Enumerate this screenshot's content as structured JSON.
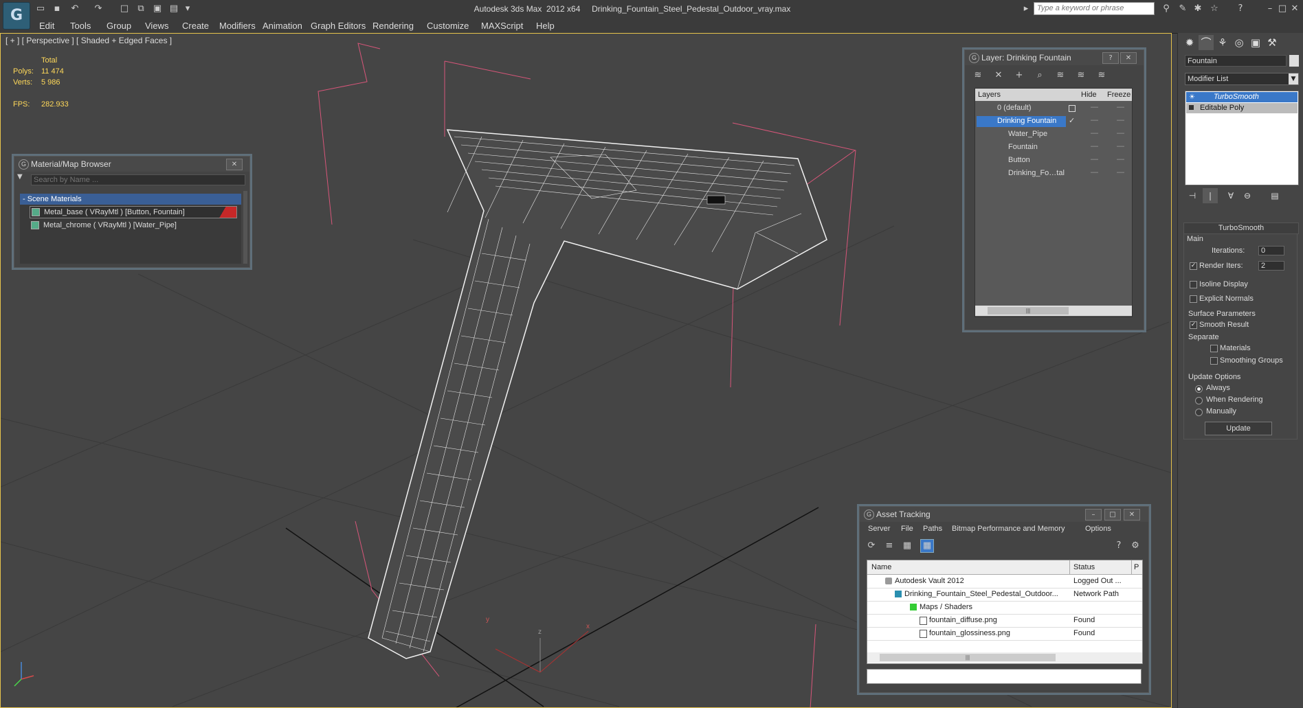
{
  "titlebar": {
    "title": "Autodesk 3ds Max  2012 x64     Drinking_Fountain_Steel_Pedestal_Outdoor_vray.max",
    "search_placeholder": "Type a keyword or phrase",
    "logo": "G"
  },
  "menu": [
    "Edit",
    "Tools",
    "Group",
    "Views",
    "Create",
    "Modifiers",
    "Animation",
    "Graph Editors",
    "Rendering",
    "Customize",
    "MAXScript",
    "Help"
  ],
  "viewport": {
    "label": "[ + ] [ Perspective ] [ Shaded + Edged Faces ]",
    "stats": {
      "total_label": "Total",
      "polys_label": "Polys:",
      "polys_value": "11 474",
      "verts_label": "Verts:",
      "verts_value": "5 986",
      "fps_label": "FPS:",
      "fps_value": "282.933"
    },
    "gizmo_axes": [
      "x",
      "y",
      "z"
    ]
  },
  "material_browser": {
    "title": "Material/Map Browser",
    "search_placeholder": "Search by Name ...",
    "group_label": "- Scene Materials",
    "items": [
      "Metal_base  ( VRayMtl )  [Button, Fountain]",
      "Metal_chrome  ( VRayMtl )  [Water_Pipe]"
    ]
  },
  "layer_window": {
    "title": "Layer: Drinking Fountain",
    "col_layers": "Layers",
    "col_hide": "Hide",
    "col_freeze": "Freeze",
    "rows": [
      {
        "label": "0 (default)",
        "indent": 0
      },
      {
        "label": "Drinking Fountain",
        "indent": 0
      },
      {
        "label": "Water_Pipe",
        "indent": 1
      },
      {
        "label": "Fountain",
        "indent": 1
      },
      {
        "label": "Button",
        "indent": 1
      },
      {
        "label": "Drinking_Fo…tal",
        "indent": 1
      }
    ],
    "scroll_grip": "|||"
  },
  "asset_tracking": {
    "title": "Asset Tracking",
    "menu": [
      "Server",
      "File",
      "Paths",
      "Bitmap Performance and Memory",
      "Options"
    ],
    "col_name": "Name",
    "col_status": "Status",
    "col_extra": "P",
    "rows": [
      {
        "name": "Autodesk Vault 2012",
        "status": "Logged Out ...",
        "indent": 1
      },
      {
        "name": "Drinking_Fountain_Steel_Pedestal_Outdoor...",
        "status": "Network Path",
        "indent": 2
      },
      {
        "name": "Maps / Shaders",
        "status": "",
        "indent": 3
      },
      {
        "name": "fountain_diffuse.png",
        "status": "Found",
        "indent": 4
      },
      {
        "name": "fountain_glossiness.png",
        "status": "Found",
        "indent": 4
      }
    ],
    "scroll_grip": "|||"
  },
  "command_panel": {
    "object_name": "Fountain",
    "modifier_list": "Modifier List",
    "stack": [
      "TurboSmooth",
      "Editable Poly"
    ],
    "rollout_title": "TurboSmooth",
    "main_label": "Main",
    "iterations_label": "Iterations:",
    "iterations_value": "0",
    "render_iters_label": "Render Iters:",
    "render_iters_value": "2",
    "isoline_label": "Isoline Display",
    "explicit_normals_label": "Explicit Normals",
    "surface_params_label": "Surface Parameters",
    "smooth_result_label": "Smooth Result",
    "separate_label": "Separate",
    "materials_label": "Materials",
    "smoothing_groups_label": "Smoothing Groups",
    "update_options_label": "Update Options",
    "always_label": "Always",
    "when_rendering_label": "When Rendering",
    "manually_label": "Manually",
    "update_button": "Update"
  },
  "colors": {
    "accent_blue": "#3a78c8",
    "viewport_border": "#e7c44c",
    "stats_yellow": "#ffd95a"
  }
}
